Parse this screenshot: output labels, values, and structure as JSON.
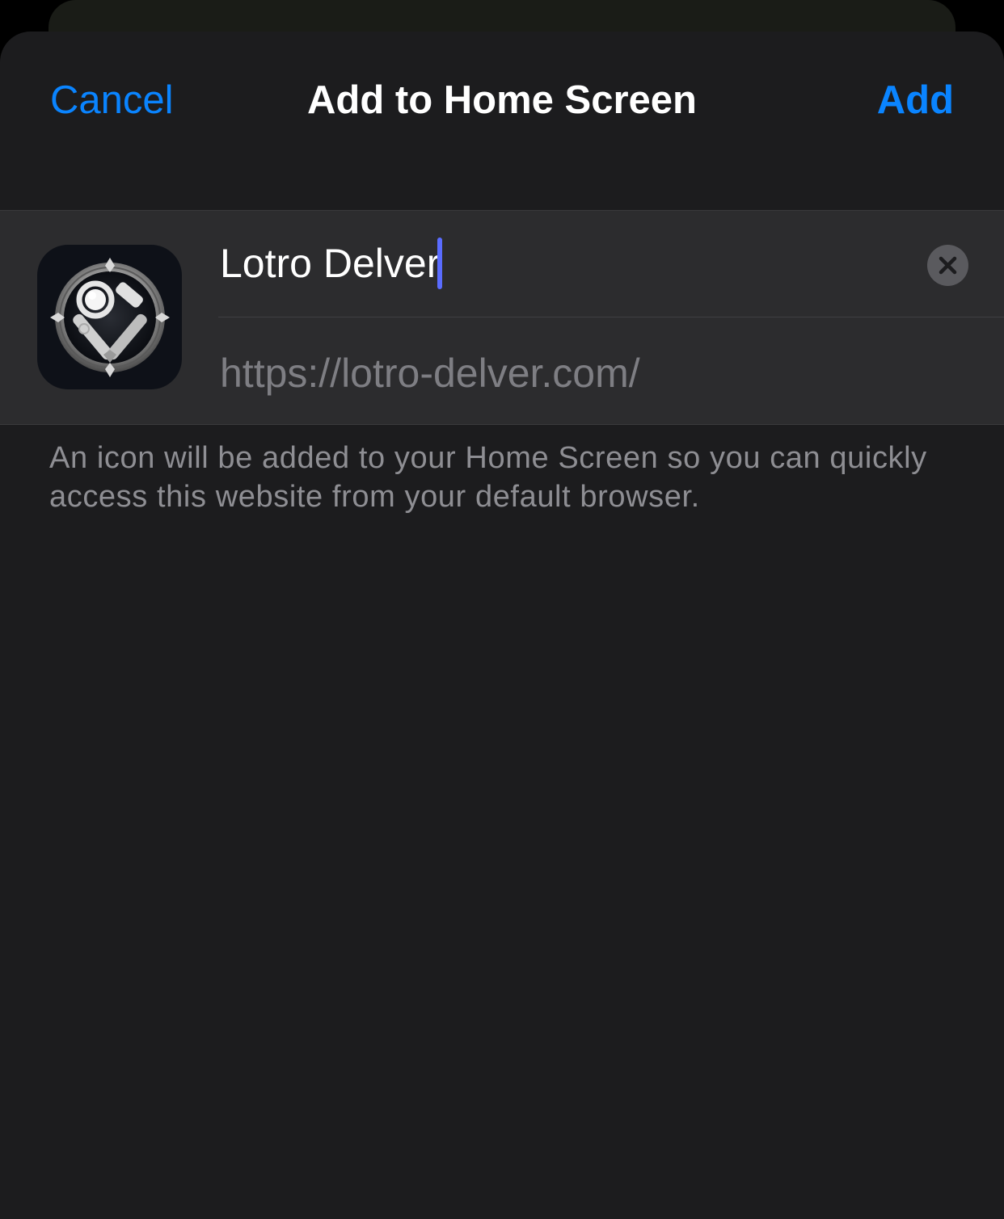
{
  "nav": {
    "cancel_label": "Cancel",
    "title": "Add to Home Screen",
    "add_label": "Add"
  },
  "bookmark": {
    "name_value": "Lotro Delver",
    "url": "https://lotro-delver.com/",
    "icon": "lotro-delver-app-icon",
    "clear_icon": "clear-x-icon"
  },
  "footer": {
    "text": "An icon will be added to your Home Screen so you can quickly access this website from your default browser."
  },
  "colors": {
    "accent": "#0a84ff",
    "sheet_background": "#1c1c1e",
    "card_background": "#2c2c2e",
    "cursor": "#5a6cff"
  }
}
